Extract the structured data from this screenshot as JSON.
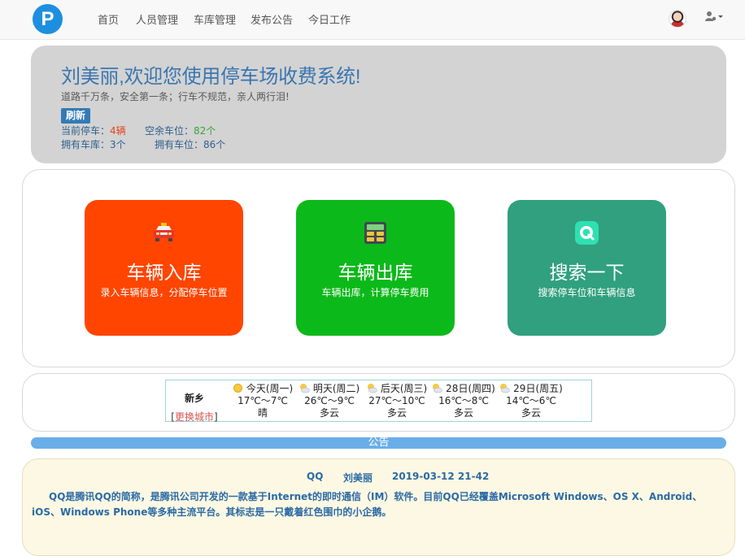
{
  "nav": {
    "logo": "P",
    "items": [
      "首页",
      "人员管理",
      "车库管理",
      "发布公告",
      "今日工作"
    ]
  },
  "jumbotron": {
    "welcome": "刘美丽,欢迎您使用停车场收费系统!",
    "motto": "道路千万条，安全第一条；行车不规范，亲人两行泪!",
    "refresh": "刷新",
    "current_parking_label": "当前停车：",
    "current_parking_value": "4辆",
    "free_spaces_label": "空余车位：",
    "free_spaces_value": "82个",
    "garages_label": "拥有车库：",
    "garages_value": "3个",
    "spaces_label": "拥有车位：",
    "spaces_value": "86个"
  },
  "cards": [
    {
      "title": "车辆入库",
      "desc": "录入车辆信息，分配停车位置",
      "color": "#ff4500",
      "icon": "taxi-icon"
    },
    {
      "title": "车辆出库",
      "desc": "车辆出库，计算停车费用",
      "color": "#0cb91a",
      "icon": "calculator-icon"
    },
    {
      "title": "搜索一下",
      "desc": "搜索停车位和车辆信息",
      "color": "#30a07e",
      "icon": "search-icon"
    }
  ],
  "weather": {
    "city": "新乡",
    "change_city": "更换城市",
    "days": [
      {
        "label": "今天(周一)",
        "temp": "17℃～7℃",
        "cond": "晴",
        "icon": "sun-icon"
      },
      {
        "label": "明天(周二)",
        "temp": "26℃～9℃",
        "cond": "多云",
        "icon": "cloud-sun-icon"
      },
      {
        "label": "后天(周三)",
        "temp": "27℃～10℃",
        "cond": "多云",
        "icon": "cloud-sun-icon"
      },
      {
        "label": "28日(周四)",
        "temp": "16℃～8℃",
        "cond": "多云",
        "icon": "cloud-sun-icon"
      },
      {
        "label": "29日(周五)",
        "temp": "14℃～6℃",
        "cond": "多云",
        "icon": "cloud-sun-icon"
      }
    ]
  },
  "notice": {
    "bar_title": "公告",
    "title": "QQ",
    "author": "刘美丽",
    "date": "2019-03-12 21-42",
    "body": "QQ是腾讯QQ的简称，是腾讯公司开发的一款基于Internet的即时通信（IM）软件。目前QQ已经覆盖Microsoft Windows、OS X、Android、iOS、Windows Phone等多种主流平台。其标志是一只戴着红色围巾的小企鹅。"
  }
}
